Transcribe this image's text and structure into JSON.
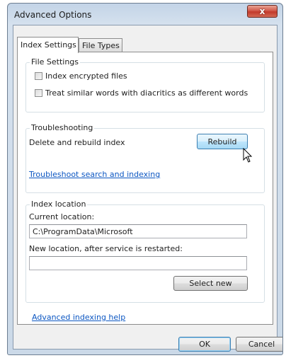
{
  "window": {
    "title": "Advanced Options",
    "close_label": "x"
  },
  "tabs": [
    {
      "label": "Index Settings",
      "active": true
    },
    {
      "label": "File Types",
      "active": false
    }
  ],
  "file_settings": {
    "legend": "File Settings",
    "options": [
      {
        "label": "Index encrypted files",
        "checked": false
      },
      {
        "label": "Treat similar words with diacritics as different words",
        "checked": false
      }
    ]
  },
  "troubleshooting": {
    "legend": "Troubleshooting",
    "rebuild_text": "Delete and rebuild index",
    "rebuild_button": "Rebuild",
    "link": "Troubleshoot search and indexing"
  },
  "index_location": {
    "legend": "Index location",
    "current_label": "Current location:",
    "current_value": "C:\\ProgramData\\Microsoft",
    "new_label": "New location, after service is restarted:",
    "new_value": "",
    "select_button": "Select new"
  },
  "help_link": "Advanced indexing help",
  "footer": {
    "ok_label": "OK",
    "cancel_label": "Cancel"
  },
  "icons": {
    "cursor": "arrow-cursor-icon"
  },
  "colors": {
    "link": "#0b56c2",
    "close_button": "#c94a3a",
    "hover_button": "#bee6fd"
  }
}
